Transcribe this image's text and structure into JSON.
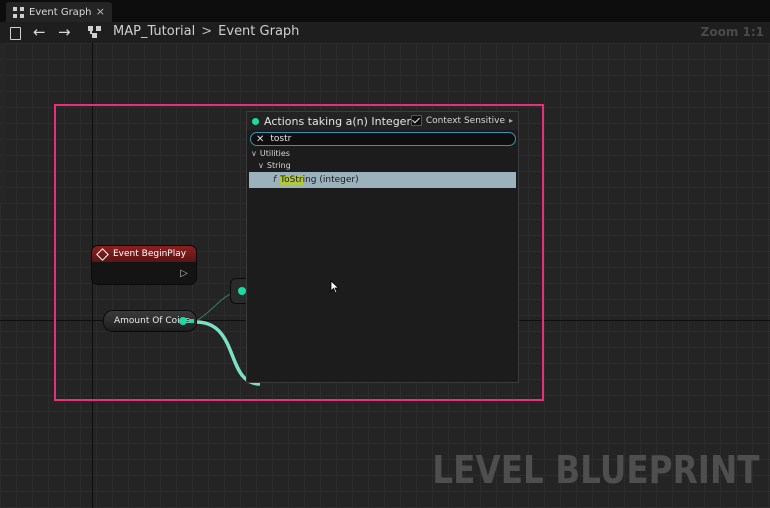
{
  "tab": {
    "title": "Event Graph",
    "close": "×"
  },
  "toolbar": {
    "back": "←",
    "forward": "→",
    "breadcrumb": [
      "MAP_Tutorial",
      "Event Graph"
    ],
    "separator": ">",
    "zoom": "Zoom 1:1"
  },
  "graph": {
    "watermark": "LEVEL BLUEPRINT",
    "nodes": {
      "begin_play": {
        "title": "Event BeginPlay",
        "exec_glyph": "▷"
      },
      "variable": {
        "label": "Amount Of Coins"
      }
    }
  },
  "action_menu": {
    "title": "Actions taking a(n) Integer",
    "context_sensitive_label": "Context Sensitive",
    "context_sensitive_checked": true,
    "search": {
      "value": "tostr",
      "clear_glyph": "✕"
    },
    "categories": [
      {
        "label": "Utilities",
        "expanded": true
      },
      {
        "label": "String",
        "expanded": true
      }
    ],
    "results": [
      {
        "glyph": "f",
        "match": "ToStr",
        "rest": "ing (integer)",
        "selected": true
      }
    ]
  },
  "colors": {
    "highlight": "#e4327a",
    "pin_integer": "#1fd9a4",
    "event_header": "#8d1f1f",
    "selection": "#9bb2bd",
    "match_highlight": "#b1c93e"
  }
}
